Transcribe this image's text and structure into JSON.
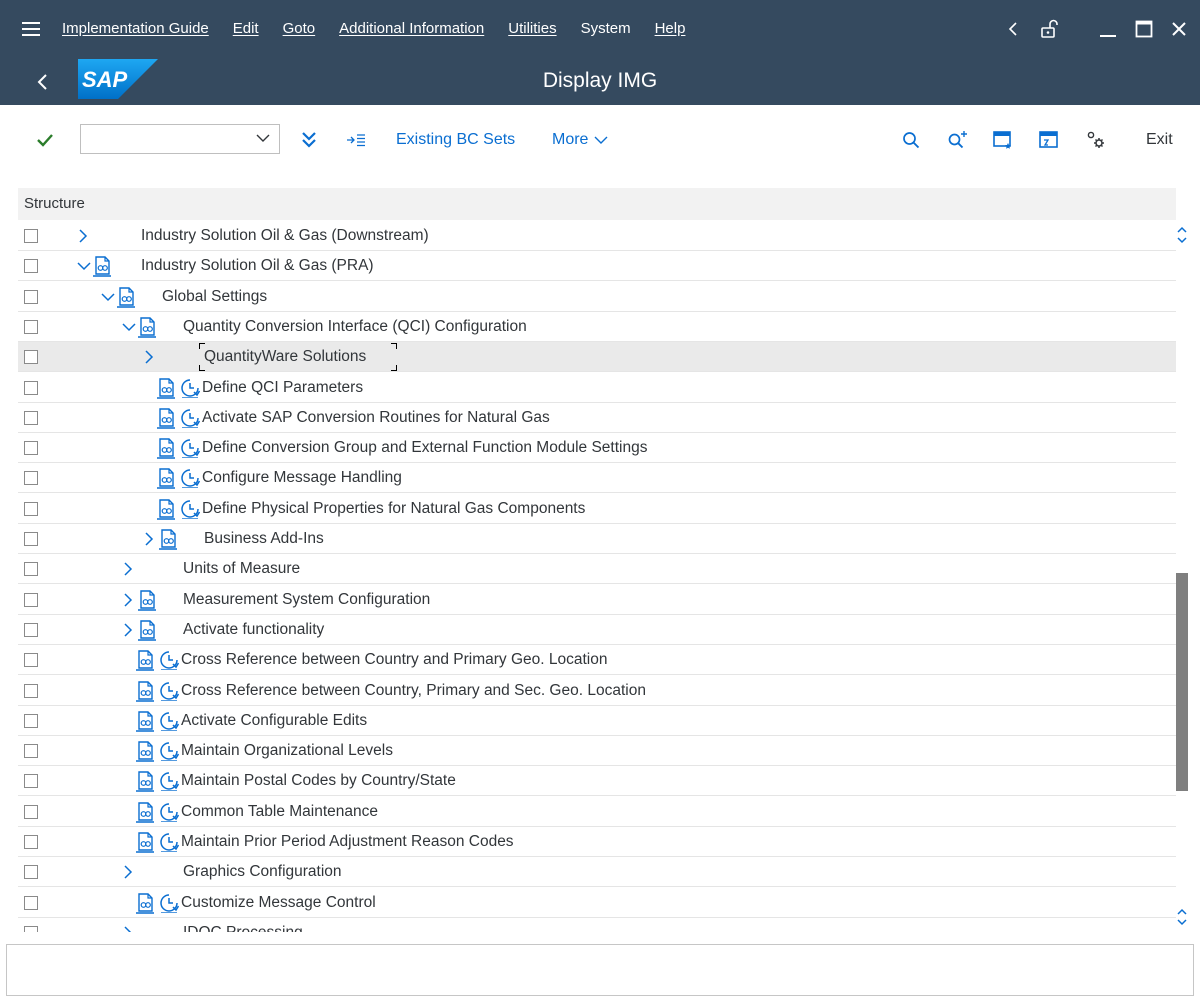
{
  "menu": {
    "items": [
      "Implementation Guide",
      "Edit",
      "Goto",
      "Additional Information",
      "Utilities",
      "System",
      "Help"
    ]
  },
  "window_controls": [
    "back-icon",
    "lock-open-icon",
    "minimize-icon",
    "maximize-icon",
    "close-icon"
  ],
  "titlebar": {
    "title": "Display IMG",
    "logo_text": "SAP"
  },
  "toolbar": {
    "command_field_value": "",
    "existing_bc_sets": "Existing BC Sets",
    "more": "More",
    "exit": "Exit"
  },
  "tree": {
    "header": "Structure",
    "rows": [
      {
        "label": "Industry Solution Oil & Gas (Downstream)",
        "level": 0,
        "expander": "collapsed",
        "doc": false,
        "clock": false
      },
      {
        "label": "Industry Solution Oil & Gas (PRA)",
        "level": 0,
        "expander": "expanded",
        "doc": true,
        "clock": false
      },
      {
        "label": "Global Settings",
        "level": 1,
        "expander": "expanded",
        "doc": true,
        "clock": false
      },
      {
        "label": "Quantity Conversion Interface (QCI) Configuration",
        "level": 2,
        "expander": "expanded",
        "doc": true,
        "clock": false
      },
      {
        "label": "QuantityWare Solutions",
        "level": 3,
        "expander": "collapsed",
        "doc": false,
        "clock": false,
        "selected": true
      },
      {
        "label": "Define QCI Parameters",
        "level": 3,
        "expander": "none",
        "doc": true,
        "clock": true
      },
      {
        "label": "Activate SAP Conversion Routines for Natural Gas",
        "level": 3,
        "expander": "none",
        "doc": true,
        "clock": true
      },
      {
        "label": "Define Conversion Group and External Function Module Settings",
        "level": 3,
        "expander": "none",
        "doc": true,
        "clock": true
      },
      {
        "label": "Configure Message Handling",
        "level": 3,
        "expander": "none",
        "doc": true,
        "clock": true
      },
      {
        "label": "Define Physical Properties for Natural Gas Components",
        "level": 3,
        "expander": "none",
        "doc": true,
        "clock": true
      },
      {
        "label": "Business Add-Ins",
        "level": 3,
        "expander": "collapsed",
        "doc": true,
        "clock": false
      },
      {
        "label": "Units of Measure",
        "level": 2,
        "expander": "collapsed",
        "doc": false,
        "clock": false
      },
      {
        "label": "Measurement System Configuration",
        "level": 2,
        "expander": "collapsed",
        "doc": true,
        "clock": false
      },
      {
        "label": "Activate functionality",
        "level": 2,
        "expander": "collapsed",
        "doc": true,
        "clock": false
      },
      {
        "label": "Cross Reference between Country and Primary Geo. Location",
        "level": 2,
        "expander": "none",
        "doc": true,
        "clock": true
      },
      {
        "label": "Cross Reference between Country, Primary and Sec. Geo. Location",
        "level": 2,
        "expander": "none",
        "doc": true,
        "clock": true
      },
      {
        "label": "Activate Configurable Edits",
        "level": 2,
        "expander": "none",
        "doc": true,
        "clock": true
      },
      {
        "label": "Maintain Organizational Levels",
        "level": 2,
        "expander": "none",
        "doc": true,
        "clock": true
      },
      {
        "label": "Maintain Postal Codes by Country/State",
        "level": 2,
        "expander": "none",
        "doc": true,
        "clock": true
      },
      {
        "label": "Common Table Maintenance",
        "level": 2,
        "expander": "none",
        "doc": true,
        "clock": true
      },
      {
        "label": "Maintain Prior Period Adjustment Reason Codes",
        "level": 2,
        "expander": "none",
        "doc": true,
        "clock": true
      },
      {
        "label": "Graphics Configuration",
        "level": 2,
        "expander": "collapsed",
        "doc": false,
        "clock": false
      },
      {
        "label": "Customize Message Control",
        "level": 2,
        "expander": "none",
        "doc": true,
        "clock": true
      },
      {
        "label": "IDOC Processing",
        "level": 2,
        "expander": "collapsed",
        "doc": false,
        "clock": false
      }
    ]
  },
  "statusbar": {
    "message": ""
  },
  "colors": {
    "shell": "#354a5f",
    "link": "#0a6ed1",
    "check": "#2b7d2b"
  }
}
